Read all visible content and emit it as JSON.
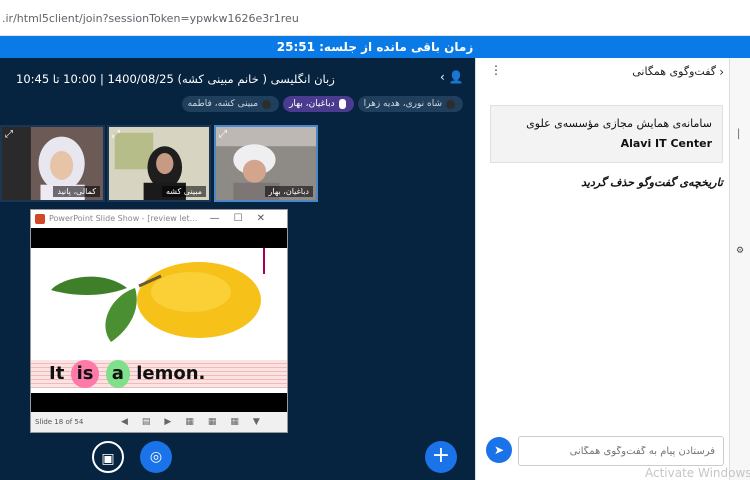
{
  "browser": {
    "url": ".ir/html5client/join?sessionToken=ypwkw1626e3r1reu"
  },
  "timer": {
    "text": "زمان باقی مانده از جلسه: 25:51"
  },
  "session": {
    "title": "زبان انگلیسی ( خانم مبینی کشه) 1400/08/25 | 10:00 تا 10:45"
  },
  "presenters": [
    {
      "label": "شاه نوری، هدیه زهرا"
    },
    {
      "label": "دباغیان، بهار",
      "active": true
    },
    {
      "label": "مبینی کشه، فاطمه"
    }
  ],
  "tiles": [
    {
      "name": "کمالی، پانید"
    },
    {
      "name": "مبینی کشه"
    },
    {
      "name": "دباغیان، بهار"
    }
  ],
  "slide": {
    "window_title": "PowerPoint Slide Show - [review let...",
    "text_it": "It",
    "text_is": "is",
    "text_a": "a",
    "text_lemon": "lemon.",
    "status": "Slide 18 of 54"
  },
  "chat": {
    "title": "گفت‌وگوی همگانی",
    "welcome_fa": "سامانه‌ی همایش مجازی مؤسسه‌ی علوی",
    "welcome_en": "Alavi IT Center",
    "cleared": "تاریخچه‌ی گفت‌وگو حذف گردید",
    "input_placeholder": "فرستادن پیام به گفت‌وگوی همگانی"
  },
  "watermark": "Activate Windows",
  "icons": {
    "user": "user-icon",
    "expand": "expand-icon",
    "camera_off": "camera-off-icon",
    "headphones": "headphones-icon",
    "plus": "plus-icon",
    "send": "send-icon",
    "menu": "kebab-menu-icon",
    "back": "chevron-left-icon",
    "settings": "gear-icon"
  },
  "colors": {
    "accent": "#1a73e8",
    "header_bar": "#0a7ae6",
    "main_bg": "#06233f"
  }
}
